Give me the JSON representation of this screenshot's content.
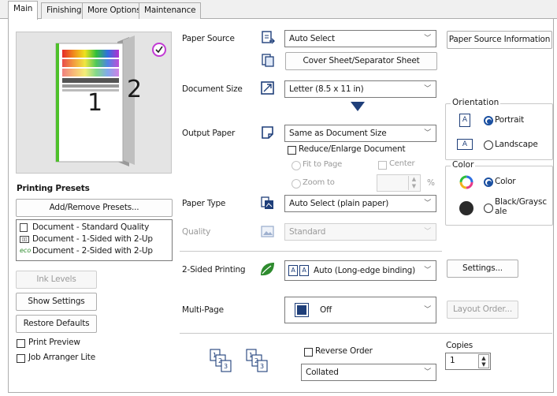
{
  "tabs": [
    "Main",
    "Finishing",
    "More Options",
    "Maintenance"
  ],
  "preview": {
    "page_number_1": "1",
    "page_number_2": "2"
  },
  "printing_presets": {
    "heading": "Printing Presets",
    "add_remove_button": "Add/Remove Presets...",
    "items": [
      "Document - Standard Quality",
      "Document - 1-Sided with 2-Up",
      "Document - 2-Sided with 2-Up"
    ]
  },
  "left_buttons": {
    "ink_levels": "Ink Levels",
    "show_settings": "Show Settings",
    "restore_defaults": "Restore Defaults"
  },
  "left_checks": {
    "print_preview": "Print Preview",
    "job_arranger_lite": "Job Arranger Lite"
  },
  "paper_source": {
    "label": "Paper Source",
    "value": "Auto Select",
    "info_button": "Paper Source Information",
    "cover_sheet_button": "Cover Sheet/Separator Sheet"
  },
  "document_size": {
    "label": "Document Size",
    "value": "Letter (8.5 x 11 in)"
  },
  "output_paper": {
    "label": "Output Paper",
    "value": "Same as Document Size",
    "reduce_enlarge": "Reduce/Enlarge Document",
    "fit_to_page": "Fit to Page",
    "center": "Center",
    "zoom_to": "Zoom to",
    "zoom_unit": "%"
  },
  "paper_type": {
    "label": "Paper Type",
    "value": "Auto Select (plain paper)"
  },
  "quality": {
    "label": "Quality",
    "value": "Standard"
  },
  "two_sided": {
    "label": "2-Sided Printing",
    "value": "Auto (Long-edge binding)",
    "settings_button": "Settings..."
  },
  "multi_page": {
    "label": "Multi-Page",
    "value": "Off",
    "layout_order_button": "Layout Order..."
  },
  "orientation": {
    "title": "Orientation",
    "portrait": "Portrait",
    "landscape": "Landscape",
    "selected": "Portrait"
  },
  "color": {
    "title": "Color",
    "color_option": "Color",
    "bw_option": "Black/Grayscale",
    "selected": "Color"
  },
  "reverse_order": "Reverse Order",
  "collate": {
    "value": "Collated"
  },
  "copies": {
    "label": "Copies",
    "value": "1"
  },
  "colors": {
    "accent": "#1a4fa0",
    "eco_green": "#2e8b2e",
    "dark_arrow": "#1f3f7a"
  }
}
